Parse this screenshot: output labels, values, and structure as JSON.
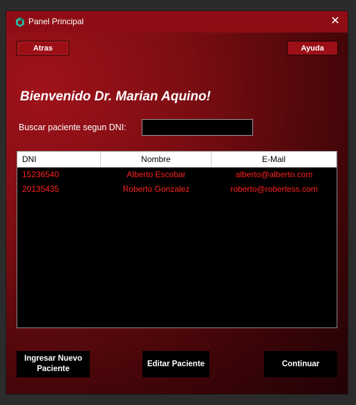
{
  "window": {
    "title": "Panel Principal",
    "close_glyph": "✕"
  },
  "toolbar": {
    "back_label": "Atras",
    "help_label": "Ayuda"
  },
  "welcome": "Bienvenido Dr. Marian Aquino!",
  "search": {
    "label": "Buscar paciente segun DNI:",
    "value": ""
  },
  "table": {
    "columns": [
      "DNI",
      "Nombre",
      "E-Mail"
    ],
    "rows": [
      {
        "dni": "15236540",
        "nombre": "Alberto Escobar",
        "email": "alberto@alberto.com"
      },
      {
        "dni": "20135435",
        "nombre": "Roberto Gonzalez",
        "email": "roberto@robertess.com"
      }
    ]
  },
  "actions": {
    "new_patient_label": "Ingresar Nuevo\nPaciente",
    "edit_patient_label": "Editar Paciente",
    "continue_label": "Continuar"
  },
  "colors": {
    "accent": "#9d0f17",
    "row_text": "#ff2020"
  },
  "icons": {
    "app": "app-logo-icon",
    "close": "close-icon"
  }
}
